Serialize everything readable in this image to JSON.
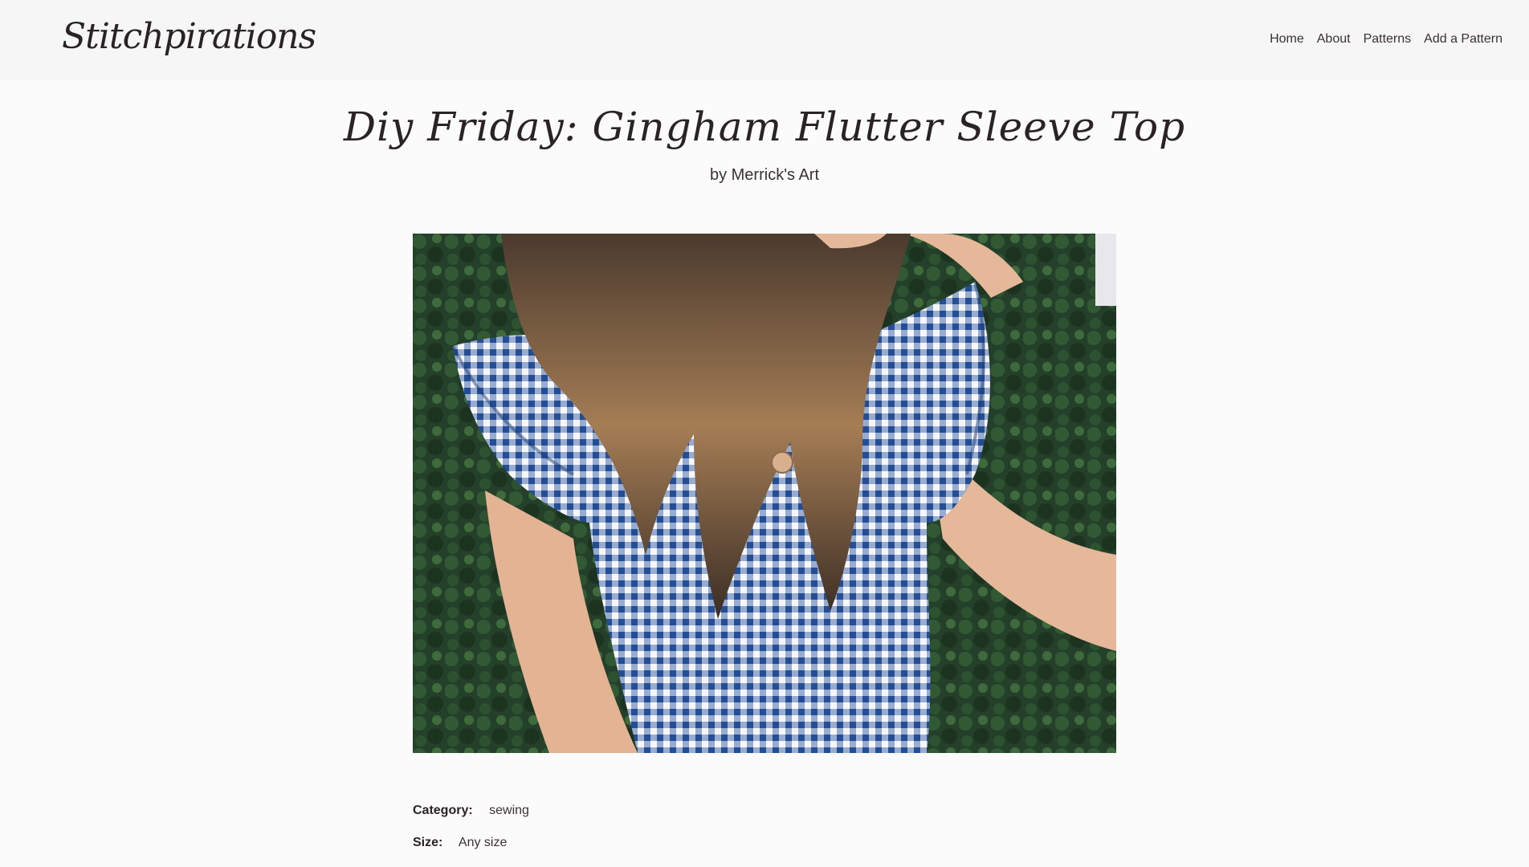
{
  "site": {
    "brand": "Stitchpirations"
  },
  "nav": {
    "items": [
      {
        "label": "Home"
      },
      {
        "label": "About"
      },
      {
        "label": "Patterns"
      },
      {
        "label": "Add a Pattern"
      }
    ]
  },
  "pattern": {
    "title": "Diy Friday: Gingham Flutter Sleeve Top",
    "byline": "by Merrick's Art",
    "image_alt": "Woman wearing a blue gingham flutter sleeve top",
    "category_label": "Category:",
    "category_value": "sewing",
    "size_label": "Size:",
    "size_value": "Any size"
  },
  "colors": {
    "navbar_bg": "#f7f6f7",
    "page_bg": "#fcfbfb",
    "text": "#2f2628",
    "gingham_blue": "#2f5a9c"
  }
}
